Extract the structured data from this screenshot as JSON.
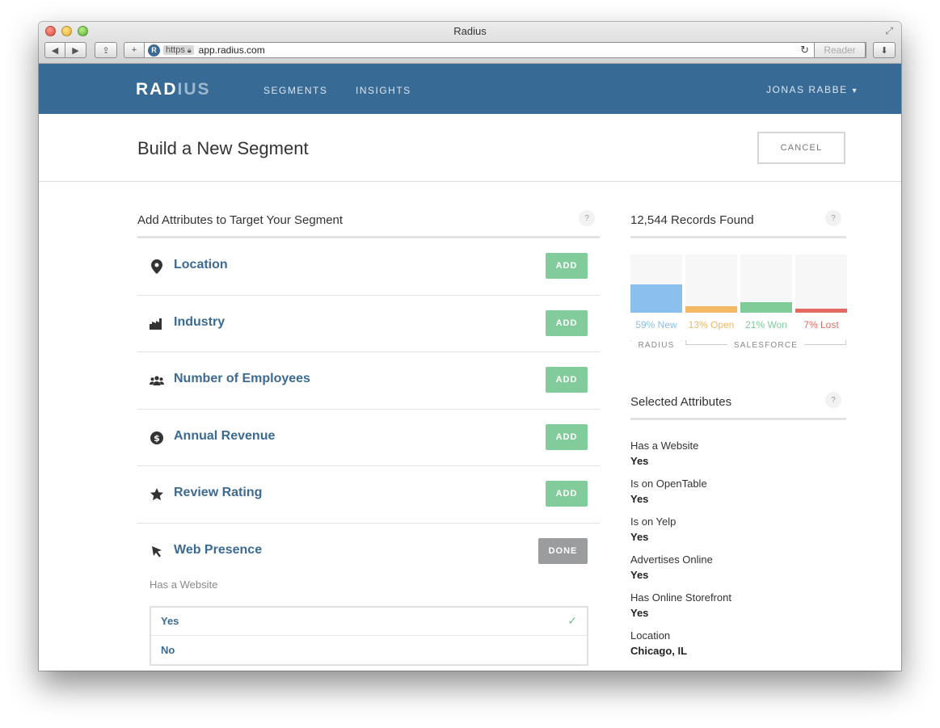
{
  "browser": {
    "window_title": "Radius",
    "protocol": "https",
    "url": "app.radius.com",
    "reader_label": "Reader",
    "site_icon_letter": "R"
  },
  "appnav": {
    "logo_main": "RAD",
    "logo_dim": "IUS",
    "links": [
      "SEGMENTS",
      "INSIGHTS"
    ],
    "user": "JONAS RABBE"
  },
  "page": {
    "title": "Build a New Segment",
    "cancel_label": "CANCEL"
  },
  "attributes": {
    "heading": "Add Attributes to Target Your Segment",
    "help": "?",
    "items": [
      {
        "label": "Location",
        "icon": "map-pin-icon",
        "button": "ADD"
      },
      {
        "label": "Industry",
        "icon": "industry-icon",
        "button": "ADD"
      },
      {
        "label": "Number of Employees",
        "icon": "people-icon",
        "button": "ADD"
      },
      {
        "label": "Annual Revenue",
        "icon": "dollar-icon",
        "button": "ADD"
      },
      {
        "label": "Review Rating",
        "icon": "star-icon",
        "button": "ADD"
      },
      {
        "label": "Web Presence",
        "icon": "cursor-icon",
        "button": "DONE"
      }
    ],
    "web_presence": {
      "question": "Has a Website",
      "options": [
        "Yes",
        "No"
      ],
      "selected": "Yes"
    }
  },
  "records": {
    "heading": "12,544 Records Found",
    "help": "?",
    "chart_data": {
      "type": "bar",
      "categories": [
        "New",
        "Open",
        "Won",
        "Lost"
      ],
      "values": [
        59,
        13,
        21,
        7
      ],
      "labels": [
        "59% New",
        "13% Open",
        "21% Won",
        "7% Lost"
      ],
      "colors": [
        "#8bbfee",
        "#f5b865",
        "#7fcc98",
        "#e56a62"
      ],
      "groups": [
        "RADIUS",
        "SALESFORCE"
      ],
      "ylim": [
        0,
        130
      ]
    }
  },
  "selected": {
    "heading": "Selected Attributes",
    "help": "?",
    "items": [
      {
        "key": "Has a Website",
        "value": "Yes"
      },
      {
        "key": "Is on OpenTable",
        "value": "Yes"
      },
      {
        "key": "Is on Yelp",
        "value": "Yes"
      },
      {
        "key": "Advertises Online",
        "value": "Yes"
      },
      {
        "key": "Has Online Storefront",
        "value": "Yes"
      },
      {
        "key": "Location",
        "value": "Chicago, IL"
      }
    ]
  }
}
